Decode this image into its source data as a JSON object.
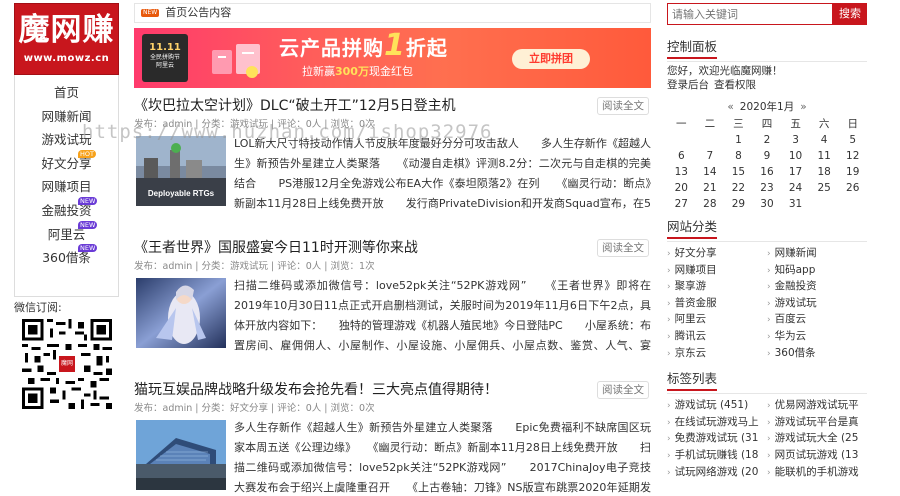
{
  "logo": {
    "main": "魔网赚",
    "url": "www.mowz.cn"
  },
  "nav": {
    "items": [
      {
        "label": "首页",
        "badge": ""
      },
      {
        "label": "网赚新闻",
        "badge": ""
      },
      {
        "label": "游戏试玩",
        "badge": ""
      },
      {
        "label": "好文分享",
        "badge": "HOT"
      },
      {
        "label": "网赚项目",
        "badge": ""
      },
      {
        "label": "金融投资",
        "badge": "NEW"
      },
      {
        "label": "阿里云",
        "badge": "NEW"
      },
      {
        "label": "360借条",
        "badge": "NEW"
      }
    ]
  },
  "wechat": {
    "label": "微信订阅:",
    "qr_center": "魔网赚"
  },
  "notice": {
    "icon": "NEW",
    "text": "首页公告内容"
  },
  "banner": {
    "card_logo": "11.11",
    "card_text": "全民拼购节",
    "brand": "阿里云",
    "title_pre": "云产品拼购",
    "title_big": "1",
    "title_post": "折起",
    "sub_pre": "拉新赢",
    "sub_bold": "300万",
    "sub_post": "现金红包",
    "button": "立即拼团"
  },
  "posts": [
    {
      "title": "《坎巴拉太空计划》DLC“破土开工”12月5日登主机",
      "read_more": "阅读全文",
      "meta": "发布：admin | 分类：游戏试玩 | 评论：0人 | 浏览：0次",
      "excerpt": "LOL新大尺寸特技动作情人节皮肤年度最好分分可攻击敌人　　多人生存新作《超越人生》新预告外星建立人类聚落　　《动漫自走棋》评测8.2分：二次元与自走棋的完美结合　　PS港服12月全免游戏公布EA大作《泰坦陨落2》在列　　《幽灵行动：断点》新副本11月28日上线免费开放　　发行商PrivateDivision和开发商Squad宣布，在5月30",
      "thumb_text": "Deployable RTGs"
    },
    {
      "title": "《王者世界》国服盛宴今日11时开测等你来战",
      "read_more": "阅读全文",
      "meta": "发布：admin | 分类：游戏试玩 | 评论：0人 | 浏览：1次",
      "excerpt": "扫描二维码或添加微信号：love52pk关注“52PK游戏网”　　《王者世界》即将在2019年10月30日11点正式开启删档测试，关服时间为2019年11月6日下午2点，具体开放内容如下：　　独特的管理游戏《机器人殖民地》今日登陆PC　　小屋系统：布置房间、雇佣佣人、小屋制作、小屋设施、小屋佣兵、小屋点数、鉴赏、人气、宴会、撤家、",
      "thumb_text": ""
    },
    {
      "title": "猫玩互娱品牌战略升级发布会抢先看！三大亮点值得期待！",
      "read_more": "阅读全文",
      "meta": "发布：admin | 分类：好文分享 | 评论：0人 | 浏览：0次",
      "excerpt": "多人生存新作《超越人生》新预告外星建立人类聚落　　Epic免费福利不缺席国区玩家本周五送《公理边缘》　　《幽灵行动：断点》新副本11月28日上线免费开放　　扫描二维码或添加微信号：love52pk关注“52PK游戏网”　　2017ChinaJoy电子竞技大赛发布会于绍兴上虞隆重召开　　《上古卷轴：刀锋》NS版宣布跳票2020年延期发售",
      "thumb_text": ""
    }
  ],
  "search": {
    "placeholder": "请输入关键词",
    "button": "搜索"
  },
  "control_panel": {
    "title": "控制面板",
    "welcome": "您好，欢迎光临魔网赚！",
    "links": [
      "登录后台",
      "查看权限"
    ]
  },
  "calendar": {
    "prev": "«",
    "caption": "2020年1月",
    "next": "»",
    "weekdays": [
      "一",
      "二",
      "三",
      "四",
      "五",
      "六",
      "日"
    ],
    "rows": [
      [
        "",
        "",
        "1",
        "2",
        "3",
        "4",
        "5"
      ],
      [
        "6",
        "7",
        "8",
        "9",
        "10",
        "11",
        "12"
      ],
      [
        "13",
        "14",
        "15",
        "16",
        "17",
        "18",
        "19"
      ],
      [
        "20",
        "21",
        "22",
        "23",
        "24",
        "25",
        "26"
      ],
      [
        "27",
        "28",
        "29",
        "30",
        "31",
        "",
        ""
      ]
    ]
  },
  "categories": {
    "title": "网站分类",
    "items": [
      "好文分享",
      "网赚新闻",
      "网赚项目",
      "知码app",
      "聚享游",
      "金融投资",
      "普资金服",
      "游戏试玩",
      "阿里云",
      "百度云",
      "腾讯云",
      "华为云",
      "京东云",
      "360借条"
    ]
  },
  "tags": {
    "title": "标签列表",
    "items": [
      "游戏试玩 (451)",
      "优易网游戏试玩平",
      "在线试玩游戏马上",
      "游戏试玩平台是真",
      "免费游戏试玩 (31",
      "游戏试玩大全 (25",
      "手机试玩赚钱 (18",
      "网页试玩游戏 (13",
      "试玩网络游戏 (20",
      "能联机的手机游戏"
    ]
  },
  "watermark": "https://www.huzhan.com/ishop32976",
  "colors": {
    "brand_red": "#c8161d",
    "badge_hot": "#f7a21b",
    "badge_new": "#6a3bd6"
  }
}
